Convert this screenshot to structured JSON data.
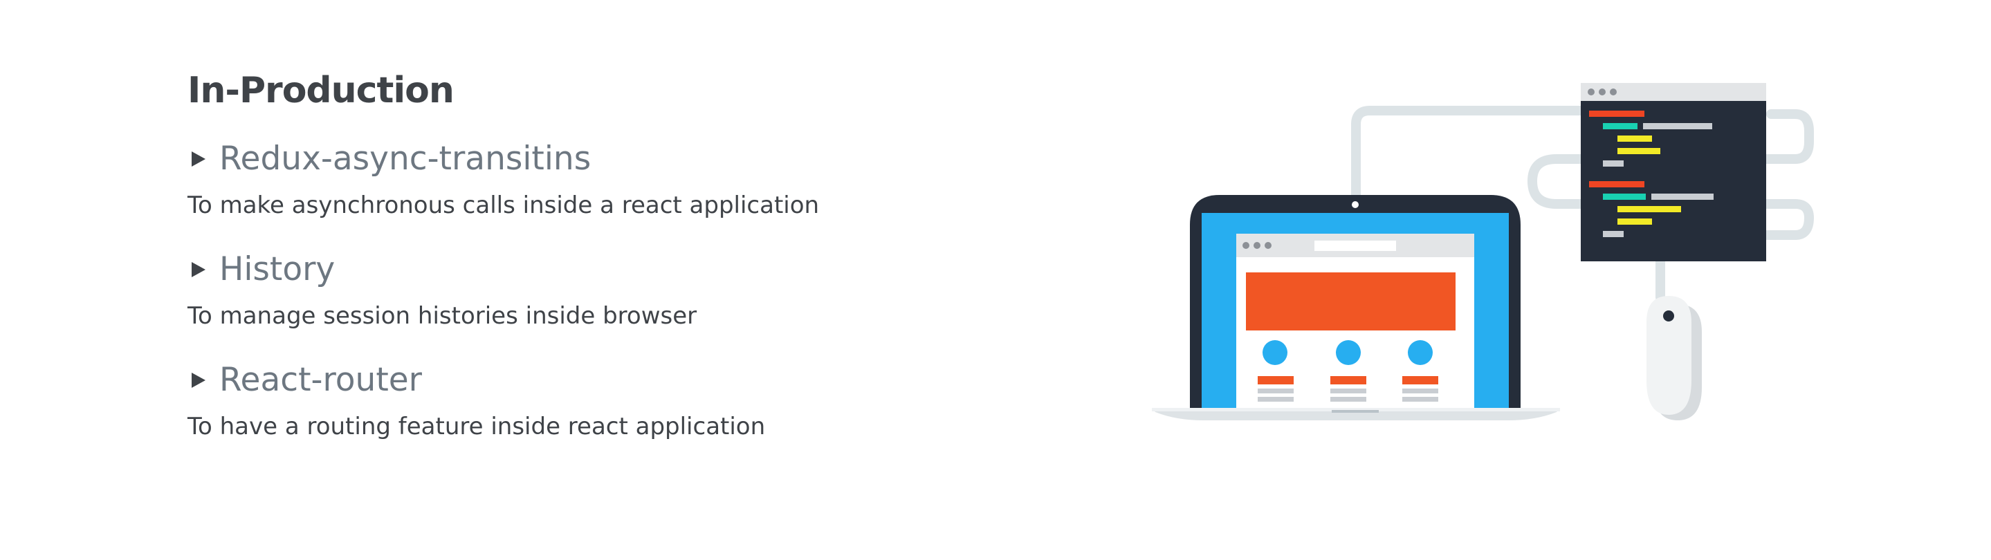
{
  "section": {
    "title": "In-Production"
  },
  "items": [
    {
      "title": "Redux-async-transitins",
      "description": "To make asynchronous calls inside a react application"
    },
    {
      "title": "History",
      "description": "To manage session histories inside browser"
    },
    {
      "title": "React-router",
      "description": "To have a routing feature inside react application"
    }
  ],
  "illustration": {
    "icons": [
      "laptop-icon",
      "code-editor-icon",
      "mouse-icon"
    ],
    "colors": {
      "laptop_frame": "#252d3a",
      "screen_blue": "#27aef0",
      "banner_orange": "#f15624",
      "cable": "#dce3e6",
      "code_red": "#ef4523",
      "code_teal": "#19d1b2",
      "code_yellow": "#f2ea27",
      "code_gray": "#c9cdd2"
    }
  }
}
